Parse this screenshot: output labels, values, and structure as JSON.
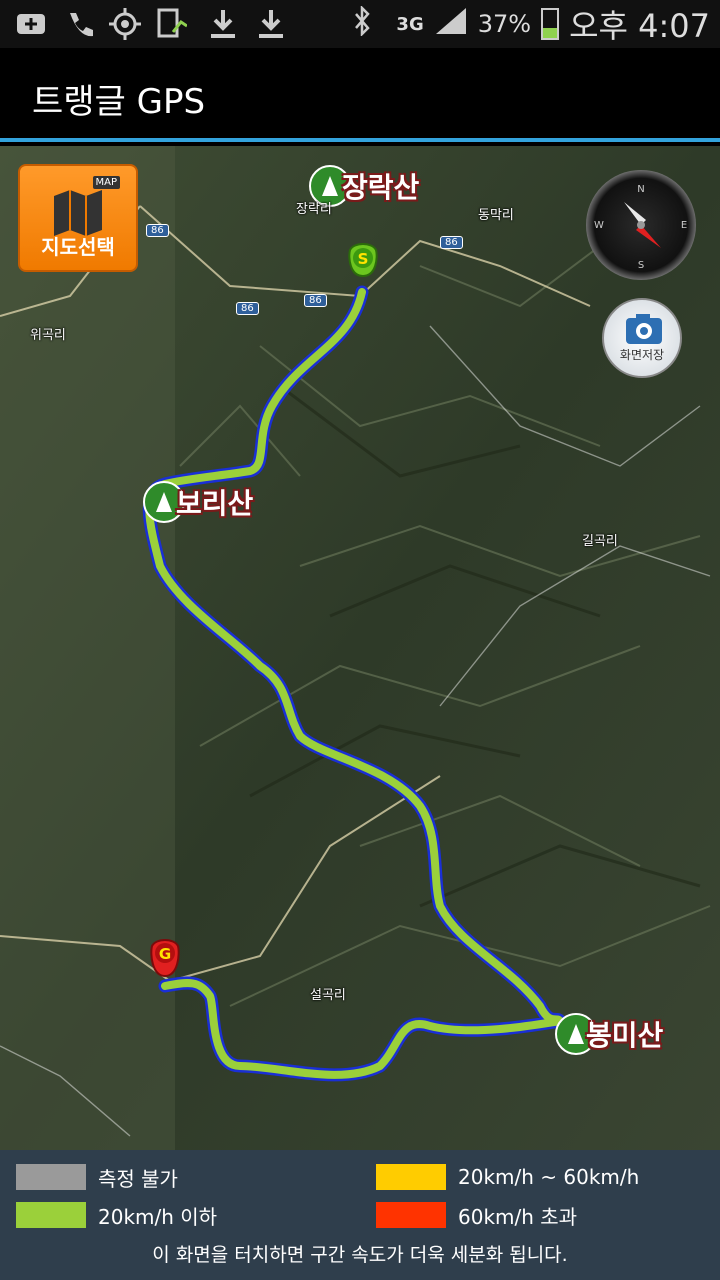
{
  "status_bar": {
    "network": "3G",
    "battery_percent": "37%",
    "time": "오후 4:07",
    "icons": [
      "add-icon",
      "phone-icon",
      "gps-icon",
      "sync-icon",
      "download-icon",
      "download-icon",
      "bluetooth-icon",
      "signal-icon",
      "battery-icon"
    ]
  },
  "app": {
    "title": "트랭글 GPS"
  },
  "map": {
    "map_select_label": "지도선택",
    "map_badge": "MAP",
    "save_label": "화면저장",
    "compass_labels": {
      "n": "N",
      "s": "S",
      "e": "E",
      "w": "W"
    },
    "peaks": [
      {
        "name": "장락산"
      },
      {
        "name": "보리산"
      },
      {
        "name": "봉미산"
      }
    ],
    "places": [
      "장락리",
      "동막리",
      "위곡리",
      "길곡리",
      "설곡리"
    ],
    "road_labels": [
      "86",
      "86",
      "86",
      "86"
    ],
    "start_marker": "S",
    "goal_marker": "G",
    "track_color": "#9bd03a",
    "track_outline_color": "#1a2fd6"
  },
  "legend": {
    "items": [
      {
        "label": "측정 불가",
        "color": "#9a9a9a"
      },
      {
        "label": "20km/h ~ 60km/h",
        "color": "#ffcc00"
      },
      {
        "label": "20km/h 이하",
        "color": "#9bd03a"
      },
      {
        "label": "60km/h 초과",
        "color": "#ff3300"
      }
    ],
    "hint": "이 화면을 터치하면 구간 속도가 더욱 세분화 됩니다."
  }
}
